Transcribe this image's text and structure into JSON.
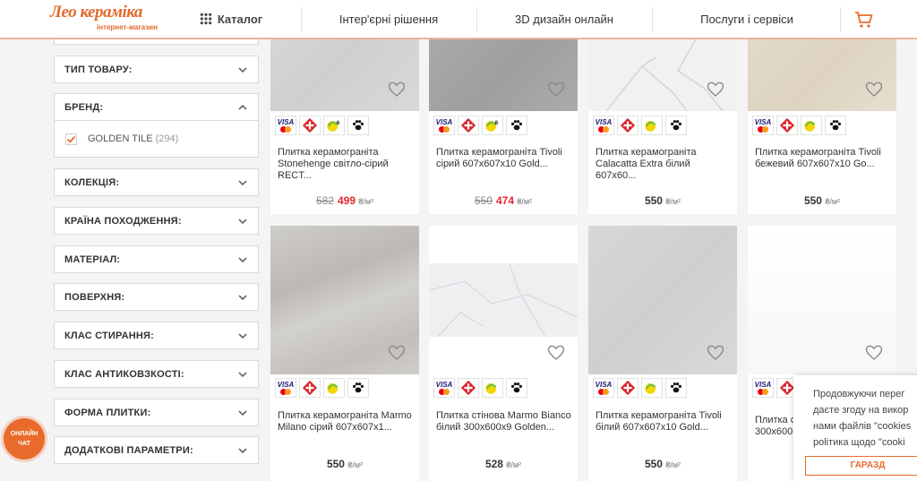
{
  "header": {
    "logo_main": "Лео кераміка",
    "logo_sub": "інтернет-магазин",
    "nav": [
      "Каталог",
      "Інтер'єрні рішення",
      "3D дизайн онлайн",
      "Послуги і сервіси"
    ]
  },
  "sidebar": {
    "filters": [
      "ТИП ТОВАРУ:",
      "БРЕНД:",
      "КОЛЕКЦІЯ:",
      "КРАЇНА ПОХОДЖЕННЯ:",
      "МАТЕРІАЛ:",
      "ПОВЕРХНЯ:",
      "КЛАС СТИРАННЯ:",
      "КЛАС АНТИКОВЗКОСТІ:",
      "ФОРМА ПЛИТКИ:",
      "ДОДАТКОВІ ПАРАМЕТРИ:"
    ],
    "brand_option": {
      "label": "GOLDEN TILE",
      "count": "(294)",
      "checked": true
    }
  },
  "products": [
    {
      "title": "Плитка керамограніта Stonehenge світло-сірий RECT...",
      "old_price": "582",
      "price": "499",
      "unit": "₴/м²",
      "sale": true
    },
    {
      "title": "Плитка керамограніта Tivoli сірий 607x607x10 Gold...",
      "old_price": "550",
      "price": "474",
      "unit": "₴/м²",
      "sale": true
    },
    {
      "title": "Плитка керамограніта Calacatta Extra білий 607x60...",
      "price": "550",
      "unit": "₴/м²",
      "sale": false
    },
    {
      "title": "Плитка керамограніта Tivoli бежевий 607x607x10 Go...",
      "price": "550",
      "unit": "₴/м²",
      "sale": false
    },
    {
      "title": "Плитка керамограніта Marmo Milano сірий 607x607x1...",
      "price": "550",
      "unit": "₴/м²",
      "sale": false
    },
    {
      "title": "Плитка стінова Marmo Bianco білий 300x600x9 Golden...",
      "price": "528",
      "unit": "₴/м²",
      "sale": false
    },
    {
      "title": "Плитка керамограніта Tivoli білий 607x607x10 Gold...",
      "price": "550",
      "unit": "₴/м²",
      "sale": false
    },
    {
      "title": "Плитка с 300x600",
      "price": "",
      "unit": "",
      "sale": false
    }
  ],
  "badges": {
    "visa": "VISA",
    "installments": "6"
  },
  "chat": {
    "line1": "ОНЛАЙН",
    "line2": "ЧАТ"
  },
  "cookie": {
    "text": "Продовжуючи перег\nдаєте згоду на викор\nнами файлів \"cookies\npolітика щодо \"cooki",
    "button": "ГАРАЗД"
  },
  "colors": {
    "accent": "#e86b2c",
    "sale_price": "#e0262e",
    "brand_orange": "#e26a2c"
  }
}
